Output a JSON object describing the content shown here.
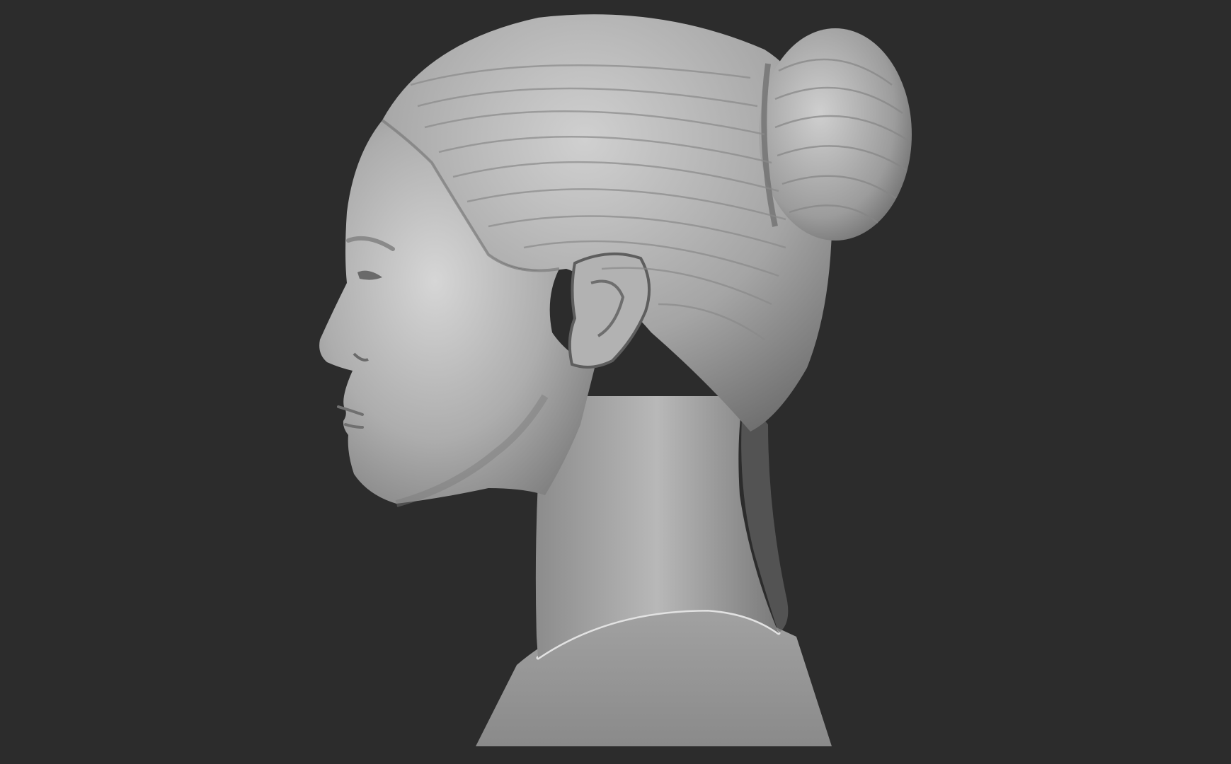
{
  "scene": {
    "subject": "bust-sculpt-profile",
    "colors": {
      "background": "#2c2c2c",
      "clay_light": "#d2d2d2",
      "clay_mid": "#a8a8a8",
      "clay_dark": "#6a6a6a",
      "shadow": "#4a4a4a"
    }
  }
}
